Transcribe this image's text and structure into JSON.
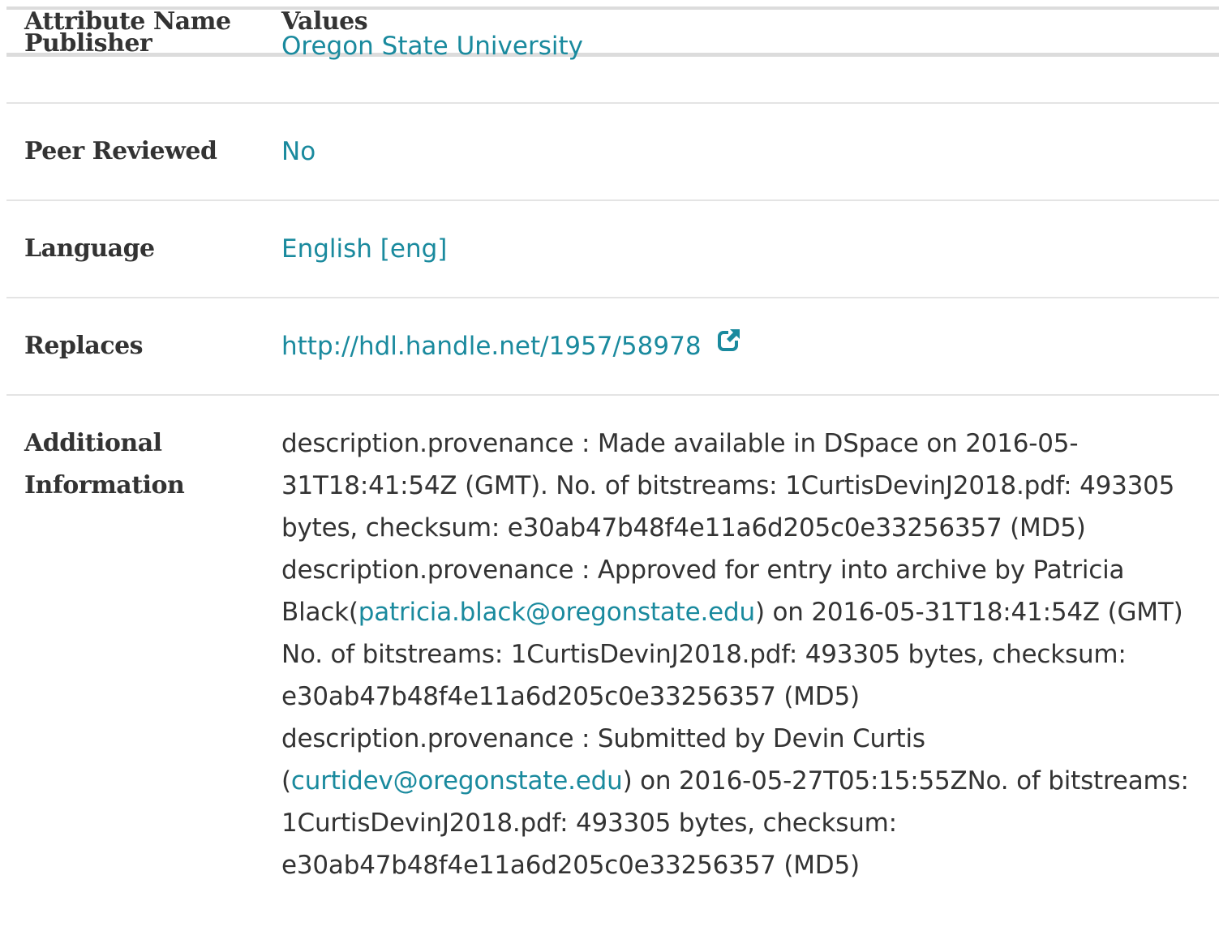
{
  "header": {
    "attribute_label": "Attribute Name",
    "values_label": "Values",
    "publisher_label": "Publisher",
    "publisher_value": "Oregon State University"
  },
  "rows": {
    "peer_reviewed": {
      "label": "Peer Reviewed",
      "value": "No"
    },
    "language": {
      "label": "Language",
      "value": "English [eng]"
    },
    "replaces": {
      "label": "Replaces",
      "value": "http://hdl.handle.net/1957/58978",
      "icon": "external-link-icon"
    },
    "additional": {
      "label_line1": "Additional",
      "label_line2": "Information",
      "prov1": "description.provenance : Made available in DSpace on 2016-05-31T18:41:54Z (GMT). No. of bitstreams: 1CurtisDevinJ2018.pdf: 493305 bytes, checksum: e30ab47b48f4e11a6d205c0e33256357 (MD5)",
      "prov2_pre": "description.provenance : Approved for entry into archive by Patricia Black(",
      "prov2_email": "patricia.black@oregonstate.edu",
      "prov2_post": ") on 2016-05-31T18:41:54Z (GMT) No. of bitstreams: 1CurtisDevinJ2018.pdf: 493305 bytes, checksum: e30ab47b48f4e11a6d205c0e33256357 (MD5)",
      "prov3_pre": "description.provenance : Submitted by Devin Curtis (",
      "prov3_email": "curtidev@oregonstate.edu",
      "prov3_post": ") on 2016-05-27T05:15:55ZNo. of bitstreams: 1CurtisDevinJ2018.pdf: 493305 bytes, checksum: e30ab47b48f4e11a6d205c0e33256357 (MD5)"
    }
  },
  "colors": {
    "link": "#1a8a9e",
    "text": "#333333",
    "rule": "#dcdcdc"
  }
}
